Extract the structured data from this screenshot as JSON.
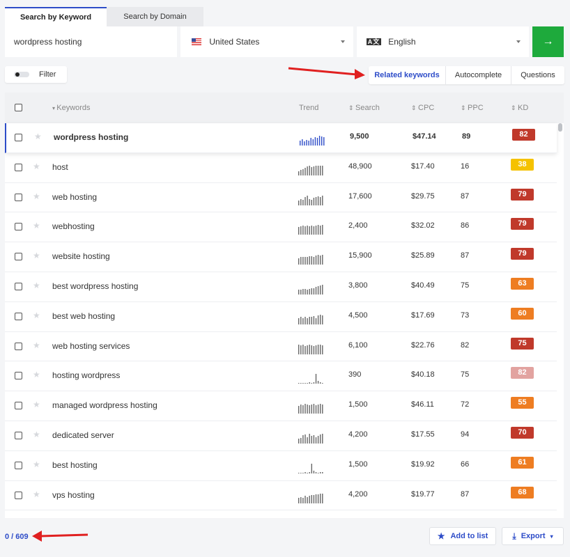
{
  "tabs": [
    {
      "label": "Search by Keyword"
    },
    {
      "label": "Search by Domain"
    }
  ],
  "search": {
    "value": "wordpress hosting"
  },
  "location": {
    "label": "United States"
  },
  "language": {
    "icon_text": "A文",
    "label": "English"
  },
  "go_icon": "→",
  "filter": {
    "label": "Filter"
  },
  "segments": [
    "Related keywords",
    "Autocomplete",
    "Questions"
  ],
  "columns": {
    "keywords": "Keywords",
    "trend": "Trend",
    "search": "Search",
    "cpc": "CPC",
    "ppc": "PPC",
    "kd": "KD"
  },
  "rows": [
    {
      "keyword": "wordpress hosting",
      "search": "9,500",
      "cpc": "$47.14",
      "ppc": "89",
      "kd": "82",
      "kd_color": "#c0392b",
      "trend": [
        6,
        8,
        5,
        7,
        6,
        9,
        8,
        10,
        9,
        12,
        11,
        10
      ]
    },
    {
      "keyword": "host",
      "search": "48,900",
      "cpc": "$17.40",
      "ppc": "16",
      "kd": "38",
      "kd_color": "#f5c200",
      "trend": [
        5,
        7,
        8,
        9,
        11,
        12,
        10,
        11,
        12,
        12,
        12,
        12
      ]
    },
    {
      "keyword": "web hosting",
      "search": "17,600",
      "cpc": "$29.75",
      "ppc": "87",
      "kd": "79",
      "kd_color": "#c0392b",
      "trend": [
        6,
        8,
        7,
        10,
        12,
        8,
        7,
        9,
        10,
        11,
        10,
        12
      ]
    },
    {
      "keyword": "webhosting",
      "search": "2,400",
      "cpc": "$32.02",
      "ppc": "86",
      "kd": "79",
      "kd_color": "#c0392b",
      "trend": [
        9,
        10,
        11,
        10,
        11,
        10,
        11,
        10,
        11,
        12,
        11,
        12
      ]
    },
    {
      "keyword": "website hosting",
      "search": "15,900",
      "cpc": "$25.89",
      "ppc": "87",
      "kd": "79",
      "kd_color": "#c0392b",
      "trend": [
        8,
        9,
        9,
        9,
        9,
        10,
        10,
        9,
        11,
        12,
        11,
        12
      ]
    },
    {
      "keyword": "best wordpress hosting",
      "search": "3,800",
      "cpc": "$40.49",
      "ppc": "75",
      "kd": "63",
      "kd_color": "#ee7d22",
      "trend": [
        6,
        6,
        7,
        7,
        6,
        7,
        8,
        8,
        9,
        10,
        11,
        12
      ]
    },
    {
      "keyword": "best web hosting",
      "search": "4,500",
      "cpc": "$17.69",
      "ppc": "73",
      "kd": "60",
      "kd_color": "#ee7d22",
      "trend": [
        8,
        9,
        8,
        9,
        8,
        9,
        9,
        10,
        8,
        11,
        12,
        11
      ]
    },
    {
      "keyword": "web hosting services",
      "search": "6,100",
      "cpc": "$22.76",
      "ppc": "82",
      "kd": "75",
      "kd_color": "#c0392b",
      "trend": [
        12,
        11,
        12,
        10,
        11,
        12,
        11,
        10,
        11,
        12,
        12,
        11
      ]
    },
    {
      "keyword": "hosting wordpress",
      "search": "390",
      "cpc": "$40.18",
      "ppc": "75",
      "kd": "82",
      "kd_color": "#e2a3a0",
      "trend": [
        1,
        1,
        1,
        1,
        1,
        2,
        1,
        2,
        12,
        3,
        2,
        1
      ]
    },
    {
      "keyword": "managed wordpress hosting",
      "search": "1,500",
      "cpc": "$46.11",
      "ppc": "72",
      "kd": "55",
      "kd_color": "#ee7d22",
      "trend": [
        9,
        11,
        10,
        12,
        11,
        10,
        11,
        12,
        10,
        11,
        12,
        11
      ]
    },
    {
      "keyword": "dedicated server",
      "search": "4,200",
      "cpc": "$17.55",
      "ppc": "94",
      "kd": "70",
      "kd_color": "#c0392b",
      "trend": [
        6,
        7,
        10,
        11,
        8,
        12,
        9,
        10,
        8,
        9,
        11,
        12
      ]
    },
    {
      "keyword": "best hosting",
      "search": "1,500",
      "cpc": "$19.92",
      "ppc": "66",
      "kd": "61",
      "kd_color": "#ee7d22",
      "trend": [
        1,
        1,
        1,
        2,
        1,
        2,
        12,
        3,
        2,
        1,
        2,
        2
      ]
    },
    {
      "keyword": "vps hosting",
      "search": "4,200",
      "cpc": "$19.77",
      "ppc": "87",
      "kd": "68",
      "kd_color": "#ee7d22",
      "trend": [
        7,
        8,
        7,
        9,
        8,
        9,
        10,
        10,
        11,
        11,
        12,
        12
      ]
    }
  ],
  "footer": {
    "count": "0 / 609",
    "add_to_list": "Add to list",
    "export": "Export"
  },
  "colors": {
    "accent": "#2d4cc8",
    "go": "#1eaa3c",
    "arrow": "#e02020"
  }
}
